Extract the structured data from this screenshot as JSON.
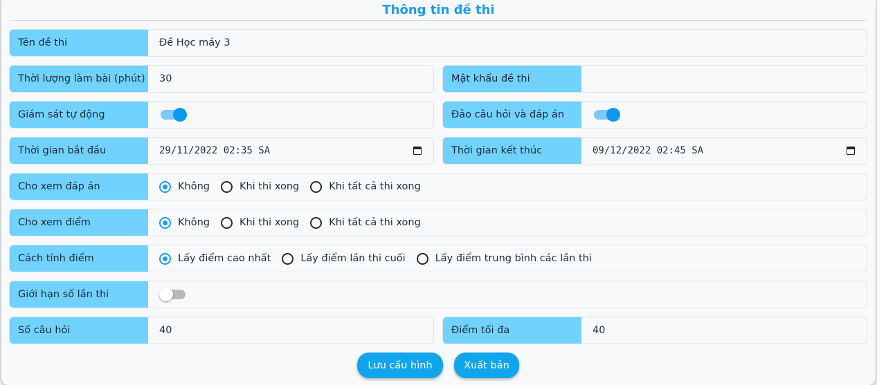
{
  "title": "Thông tin đề thi",
  "fields": {
    "exam_name": {
      "label": "Tên đề thi",
      "value": "Đề Học máy 3"
    },
    "duration": {
      "label": "Thời lượng làm bài (phút)",
      "value": "30"
    },
    "password": {
      "label": "Mật khẩu đề thi",
      "value": ""
    },
    "auto_monitor": {
      "label": "Giám sát tự động",
      "on": true
    },
    "shuffle": {
      "label": "Đảo câu hỏi và đáp án",
      "on": true
    },
    "start_time": {
      "label": "Thời gian bắt đầu",
      "value": "29/11/2022 02:35 SA"
    },
    "end_time": {
      "label": "Thời gian kết thúc",
      "value": "09/12/2022 02:45 SA"
    },
    "show_answers": {
      "label": "Cho xem đáp án",
      "options": [
        "Không",
        "Khi thi xong",
        "Khi tất cả thi xong"
      ],
      "selected": "Không"
    },
    "show_score": {
      "label": "Cho xem điểm",
      "options": [
        "Không",
        "Khi thi xong",
        "Khi tất cả thi xong"
      ],
      "selected": "Không"
    },
    "scoring": {
      "label": "Cách tính điểm",
      "options": [
        "Lấy điểm cao nhất",
        "Lấy điểm lần thi cuối",
        "Lấy điểm trung bình các lần thi"
      ],
      "selected": "Lấy điểm cao nhất"
    },
    "attempt_limit": {
      "label": "Giới hạn số lần thi",
      "on": false
    },
    "question_count": {
      "label": "Số câu hỏi",
      "value": "40"
    },
    "max_score": {
      "label": "Điểm tối đa",
      "value": "40"
    }
  },
  "buttons": {
    "save": "Lưu cấu hình",
    "publish": "Xuất bản"
  },
  "colors": {
    "accent": "#1e9ce6",
    "label_bg": "#70d2fd",
    "button_bg": "#11a5ee"
  }
}
